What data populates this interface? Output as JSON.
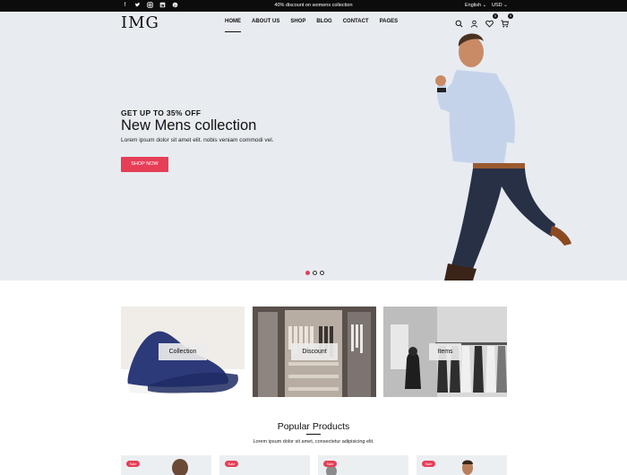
{
  "topbar": {
    "socials": [
      "facebook-icon",
      "twitter-icon",
      "instagram-icon",
      "linkedin-icon",
      "pinterest-icon"
    ],
    "promo": "40% discount on womens collection",
    "language": "English",
    "currency": "USD"
  },
  "header": {
    "logo": "IMG",
    "nav": [
      "HOME",
      "ABOUT US",
      "SHOP",
      "BLOG",
      "CONTACT",
      "PAGES"
    ],
    "wishlist_count": "0",
    "cart_count": "0"
  },
  "hero": {
    "eyebrow": "GET UP TO 35% OFF",
    "title": "New Mens collection",
    "description": "Lorem ipsum dolor sit amet elit. nobis veniam commodi vel.",
    "cta": "SHOP NOW",
    "slides": 3,
    "active_slide": 1
  },
  "categories": [
    {
      "label": "Collection"
    },
    {
      "label": "Discount"
    },
    {
      "label": "Items"
    }
  ],
  "popular": {
    "title": "Popular Products",
    "subtitle": "Lorem ipsum dolor sit amet, consectetur adipisicing elit.",
    "badges": [
      "Sale",
      "Sale",
      "Sale",
      "Sale"
    ]
  },
  "colors": {
    "accent": "#e63e57",
    "hero_bg": "#e8ecf1",
    "topbar_bg": "#0c0c0c"
  }
}
